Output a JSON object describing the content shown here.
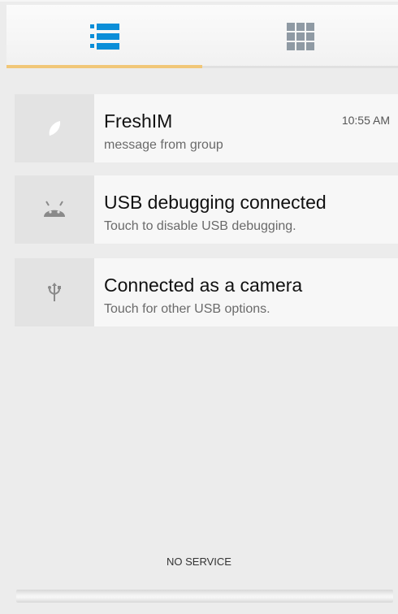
{
  "tabs": [
    {
      "name": "notifications-list",
      "icon": "list-icon",
      "active": true
    },
    {
      "name": "quick-settings",
      "icon": "grid-icon",
      "active": false
    }
  ],
  "notifications": [
    {
      "title": "FreshIM",
      "subtitle": "message from group",
      "time": "10:55 AM",
      "icon": "leaf-icon"
    },
    {
      "title": "USB debugging connected",
      "subtitle": "Touch to disable USB debugging.",
      "time": "",
      "icon": "android-icon"
    },
    {
      "title": "Connected as a camera",
      "subtitle": "Touch for other USB options.",
      "time": "",
      "icon": "usb-icon"
    }
  ],
  "status": {
    "carrier": "NO SERVICE"
  },
  "colors": {
    "accent": "#f1c778",
    "icon_blue": "#0b8ed8",
    "background": "#ececec"
  }
}
